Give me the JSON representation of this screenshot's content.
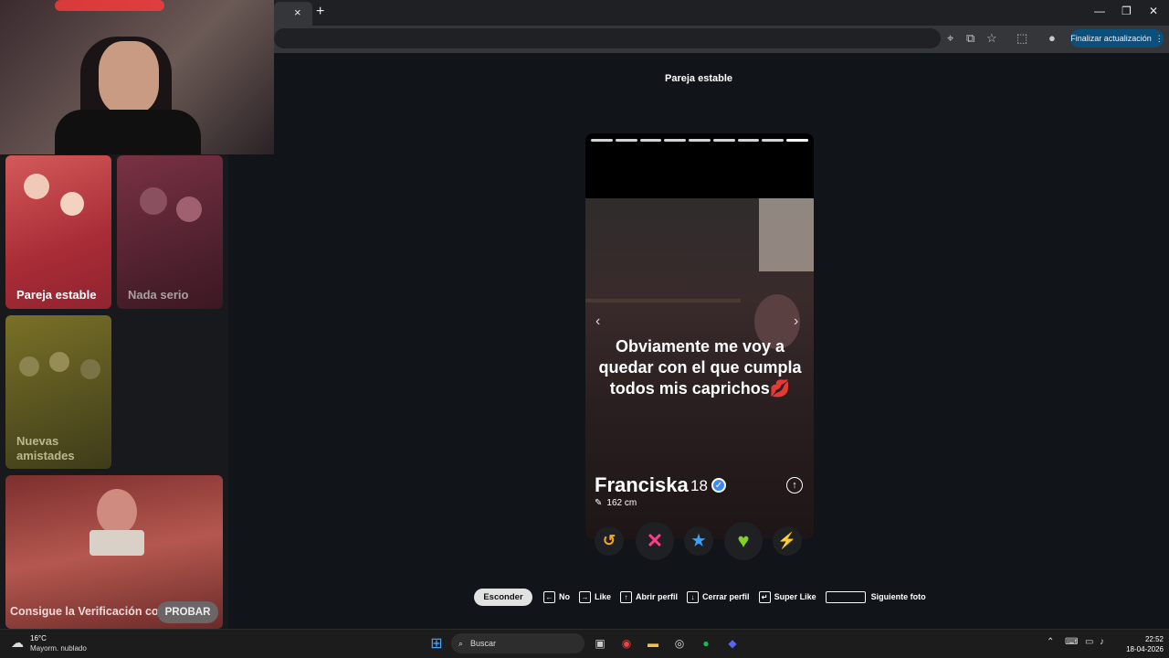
{
  "browser": {
    "tab_close": "×",
    "new_tab": "+",
    "minimize": "—",
    "maximize": "❐",
    "close": "✕",
    "update_label": "Finalizar actualización",
    "update_menu": "⋮"
  },
  "left_panel": {
    "cards": [
      {
        "label": "Pareja estable"
      },
      {
        "label": "Nada serio"
      },
      {
        "label": "Nuevas amistades"
      },
      {
        "label": "Consigue la Verificación co"
      }
    ],
    "probar_label": "PROBAR"
  },
  "main": {
    "title": "Pareja estable",
    "photo_caption": "Obviamente me voy a quedar con el que cumpla todos mis caprichos💋",
    "profile": {
      "name": "Franciska",
      "age": "18",
      "height": "162 cm"
    },
    "photo_count": 9,
    "nav_prev": "‹",
    "nav_next": "›"
  },
  "actions": {
    "rewind": "↺",
    "nope": "✕",
    "super_like": "★",
    "like": "♥",
    "boost": "⚡"
  },
  "hints": {
    "hide_label": "Esconder",
    "items": [
      {
        "key": "←",
        "label": "No"
      },
      {
        "key": "→",
        "label": "Like"
      },
      {
        "key": "↑",
        "label": "Abrir perfil"
      },
      {
        "key": "↓",
        "label": "Cerrar perfil"
      },
      {
        "key": "↵",
        "label": "Super Like"
      }
    ],
    "space_label": "Siguiente foto"
  },
  "taskbar": {
    "temperature": "16°C",
    "weather": "Mayorm. nublado",
    "search_placeholder": "Buscar",
    "time": "22:52",
    "date": "18-04-2026"
  },
  "colors": {
    "nope": "#ff3b8a",
    "like": "#7ed321",
    "super_like": "#3aa0ff",
    "rewind": "#f5a623",
    "boost": "#b34dff",
    "update_button": "#0b4f7a"
  }
}
